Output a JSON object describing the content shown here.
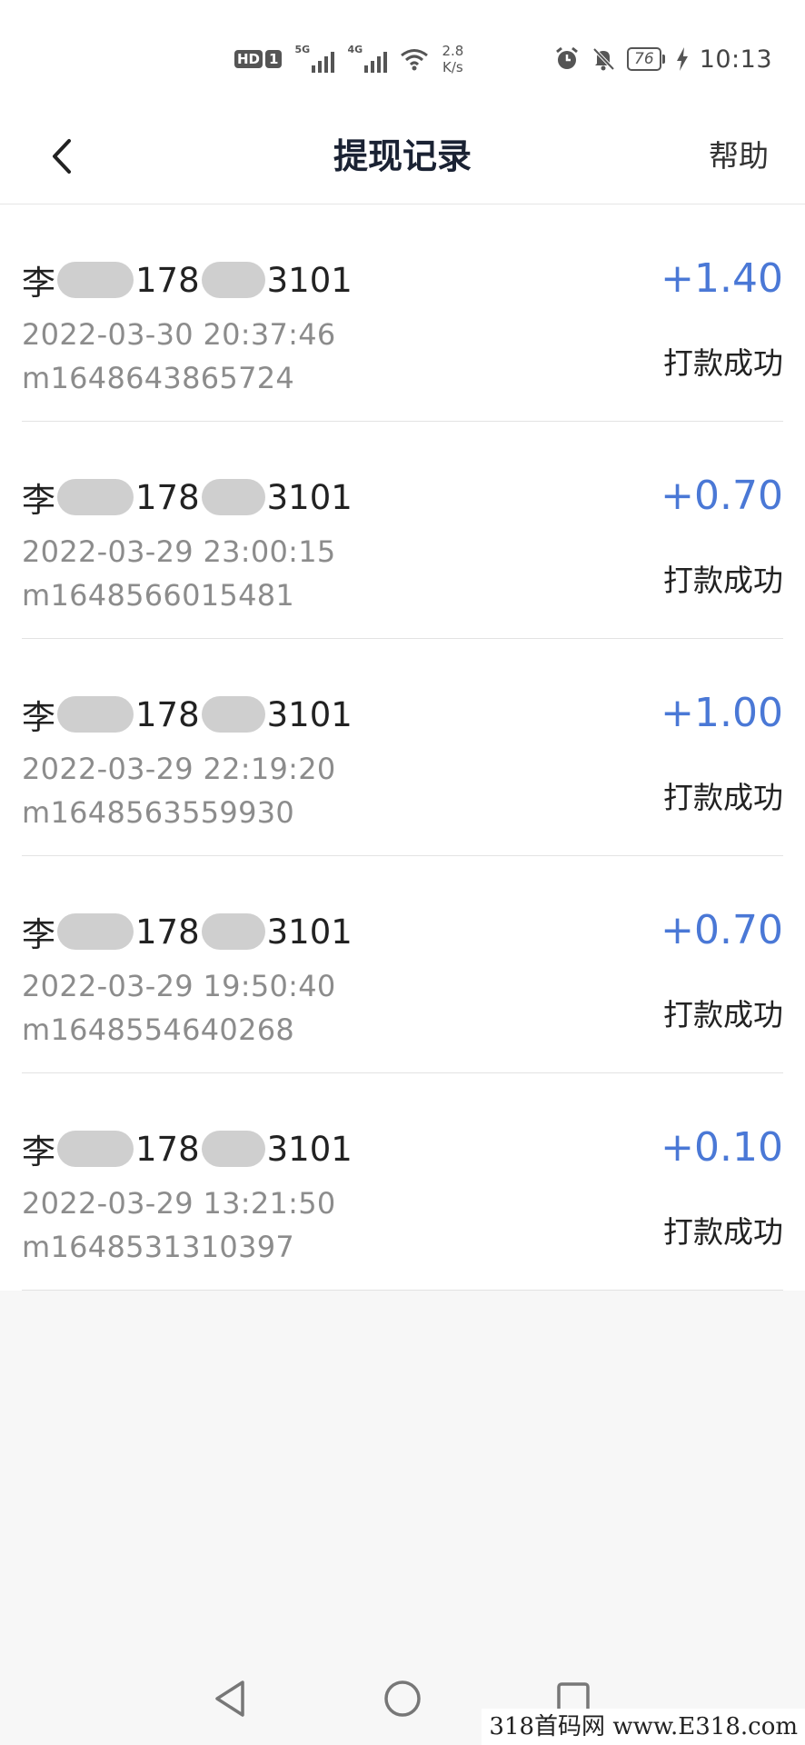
{
  "status_bar": {
    "hd": "HD",
    "sim": "1",
    "sim1_gen": "5G",
    "sim2_gen": "4G",
    "speed_value": "2.8",
    "speed_unit": "K/s",
    "battery": "76",
    "time": "10:13"
  },
  "header": {
    "title": "提现记录",
    "help_label": "帮助"
  },
  "records": [
    {
      "name_prefix": "李",
      "phone_prefix": "178",
      "phone_suffix": "3101",
      "time": "2022-03-30 20:37:46",
      "order_no": "m1648643865724",
      "amount": "+1.40",
      "status": "打款成功"
    },
    {
      "name_prefix": "李",
      "phone_prefix": "178",
      "phone_suffix": "3101",
      "time": "2022-03-29 23:00:15",
      "order_no": "m1648566015481",
      "amount": "+0.70",
      "status": "打款成功"
    },
    {
      "name_prefix": "李",
      "phone_prefix": "178",
      "phone_suffix": "3101",
      "time": "2022-03-29 22:19:20",
      "order_no": "m1648563559930",
      "amount": "+1.00",
      "status": "打款成功"
    },
    {
      "name_prefix": "李",
      "phone_prefix": "178",
      "phone_suffix": "3101",
      "time": "2022-03-29 19:50:40",
      "order_no": "m1648554640268",
      "amount": "+0.70",
      "status": "打款成功"
    },
    {
      "name_prefix": "李",
      "phone_prefix": "178",
      "phone_suffix": "3101",
      "time": "2022-03-29 13:21:50",
      "order_no": "m1648531310397",
      "amount": "+0.10",
      "status": "打款成功"
    }
  ],
  "colors": {
    "amount": "#4a78d6",
    "title": "#1a2233",
    "secondary_text": "#8c8c8c"
  },
  "icons": [
    "back-chevron-icon",
    "alarm-icon",
    "bell-muted-icon",
    "battery-icon",
    "charging-bolt-icon",
    "wifi-icon",
    "signal-icon"
  ],
  "watermark": "318首码网 www.E318.com"
}
